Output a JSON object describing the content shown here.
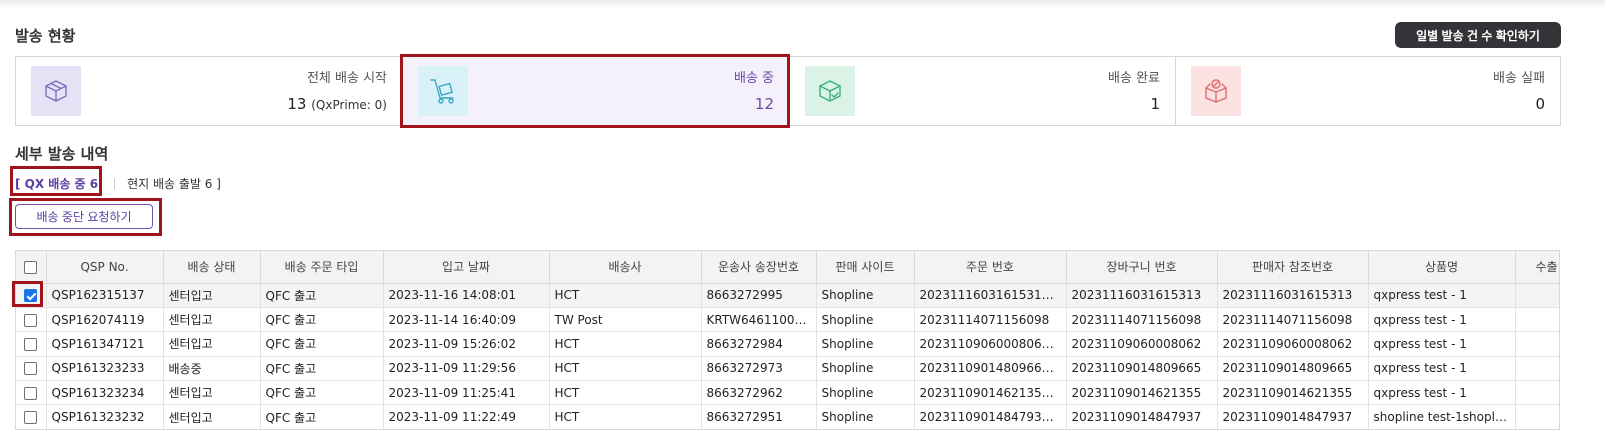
{
  "shipping_status": {
    "title": "발송 현황",
    "daily_button": "일별 발송 건 수 확인하기",
    "cards": [
      {
        "label": "전체 배송 시작",
        "value": "13",
        "sub": "(QxPrime: 0)",
        "icon": "box-icon",
        "icon_color": "#7d6fc0",
        "bg": "#e6e2f5"
      },
      {
        "label": "배송 중",
        "value": "12",
        "sub": "",
        "icon": "hand-truck-icon",
        "icon_color": "#3ba8c4",
        "bg": "#d9f2f7"
      },
      {
        "label": "배송 완료",
        "value": "1",
        "sub": "",
        "icon": "box-check-icon",
        "icon_color": "#3ab07a",
        "bg": "#daf3e6"
      },
      {
        "label": "배송 실패",
        "value": "0",
        "sub": "",
        "icon": "box-fail-icon",
        "icon_color": "#e06a6a",
        "bg": "#fbe1e1"
      }
    ]
  },
  "details": {
    "title": "세부 발송 내역",
    "tabs": [
      {
        "label": "[ QX 배송 중 6",
        "active": true
      },
      {
        "label": "현지 배송 출발 6 ]",
        "active": false
      }
    ],
    "stop_button": "배송 중단 요청하기"
  },
  "table": {
    "columns": [
      "QSP No.",
      "배송 상태",
      "배송 주문 타입",
      "입고 날짜",
      "배송사",
      "운송사 송장번호",
      "판매 사이트",
      "주문 번호",
      "장바구니 번호",
      "판매자 참조번호",
      "상품명",
      "수출"
    ],
    "rows": [
      {
        "checked": true,
        "cells": [
          "QSP162315137",
          "센터입고",
          "QFC 출고",
          "2023-11-16 14:08:01",
          "HCT",
          "8663272995",
          "Shopline",
          "202311160316153​13,2...",
          "20231116031615313",
          "20231116031615313",
          "qxpress test - 1",
          ""
        ]
      },
      {
        "checked": false,
        "cells": [
          "QSP162074119",
          "센터입고",
          "QFC 출고",
          "2023-11-14 16:40:09",
          "TW Post",
          "KRTW64611000...",
          "Shopline",
          "20231114071156098",
          "20231114071156098",
          "20231114071156098",
          "qxpress test - 1",
          ""
        ]
      },
      {
        "checked": false,
        "cells": [
          "QSP161347121",
          "센터입고",
          "QFC 출고",
          "2023-11-09 15:26:02",
          "HCT",
          "8663272984",
          "Shopline",
          "20231109060008062,2...",
          "20231109060008062",
          "20231109060008062",
          "qxpress test - 1",
          ""
        ]
      },
      {
        "checked": false,
        "cells": [
          "QSP161323233",
          "배송중",
          "QFC 출고",
          "2023-11-09 11:29:56",
          "HCT",
          "8663272973",
          "Shopline",
          "20231109014809665,2...",
          "20231109014809665",
          "20231109014809665",
          "qxpress test - 1",
          ""
        ]
      },
      {
        "checked": false,
        "cells": [
          "QSP161323234",
          "센터입고",
          "QFC 출고",
          "2023-11-09 11:25:41",
          "HCT",
          "8663272962",
          "Shopline",
          "20231109014621355,2...",
          "20231109014621355",
          "20231109014621355",
          "qxpress test - 1",
          ""
        ]
      },
      {
        "checked": false,
        "cells": [
          "QSP161323232",
          "센터입고",
          "QFC 출고",
          "2023-11-09 11:22:49",
          "HCT",
          "8663272951",
          "Shopline",
          "20231109014847937,2...",
          "20231109014847937",
          "20231109014847937",
          "shopline test-1shoplin...",
          ""
        ]
      }
    ]
  }
}
